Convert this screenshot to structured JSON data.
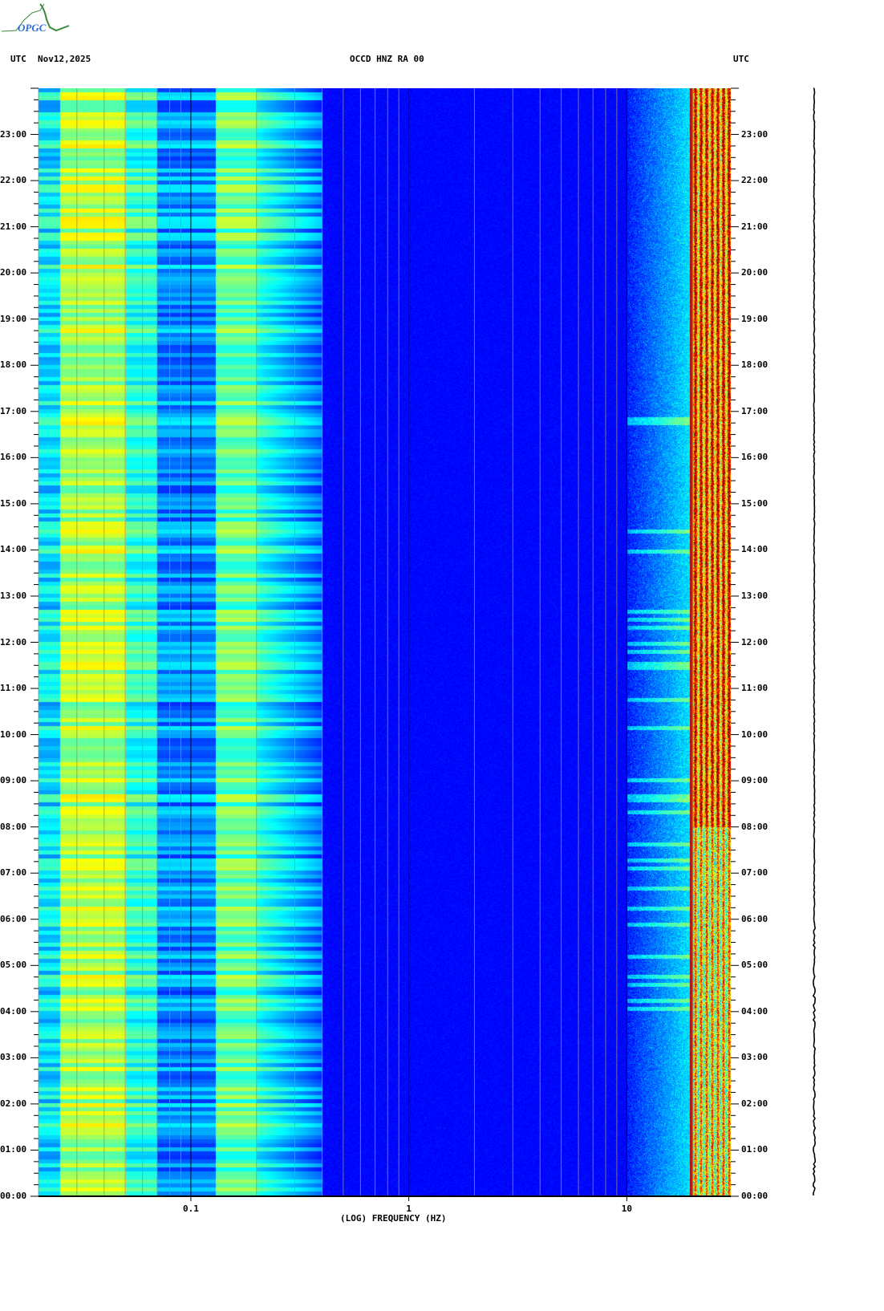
{
  "logo_text": "OPGC",
  "header": {
    "left_tz": "UTC",
    "date": "Nov12,2025",
    "station": "OCCD HNZ RA 00",
    "right_tz": "UTC"
  },
  "chart_data": {
    "type": "heatmap",
    "title": "OCCD HNZ RA 00",
    "date": "Nov12,2025",
    "xlabel": "(LOG) FREQUENCY (HZ)",
    "xscale": "log",
    "xlim": [
      0.02,
      30
    ],
    "x_ticks": [
      {
        "value": 0.1,
        "label": "0.1"
      },
      {
        "value": 1,
        "label": "1"
      },
      {
        "value": 10,
        "label": "10"
      }
    ],
    "ylabel": "UTC",
    "ylim_hours": [
      0,
      24
    ],
    "y_ticks": [
      "00:00",
      "01:00",
      "02:00",
      "03:00",
      "04:00",
      "05:00",
      "06:00",
      "07:00",
      "08:00",
      "09:00",
      "10:00",
      "11:00",
      "12:00",
      "13:00",
      "14:00",
      "15:00",
      "16:00",
      "17:00",
      "18:00",
      "19:00",
      "20:00",
      "21:00",
      "22:00",
      "23:00"
    ],
    "colormap": "jet",
    "features": [
      {
        "band_hz": [
          0.025,
          0.05
        ],
        "level": "high (cyan-yellow)"
      },
      {
        "band_hz": [
          0.13,
          0.2
        ],
        "level": "medium-high (cyan-yellow)"
      },
      {
        "band_hz": [
          0.4,
          10
        ],
        "level": "low (dark blue)"
      },
      {
        "band_hz": [
          19.5,
          20
        ],
        "level": "very high (red line)"
      },
      {
        "band_hz": [
          20,
          30
        ],
        "level": "high (yellow-red), stronger 08:00-24:00"
      }
    ]
  }
}
